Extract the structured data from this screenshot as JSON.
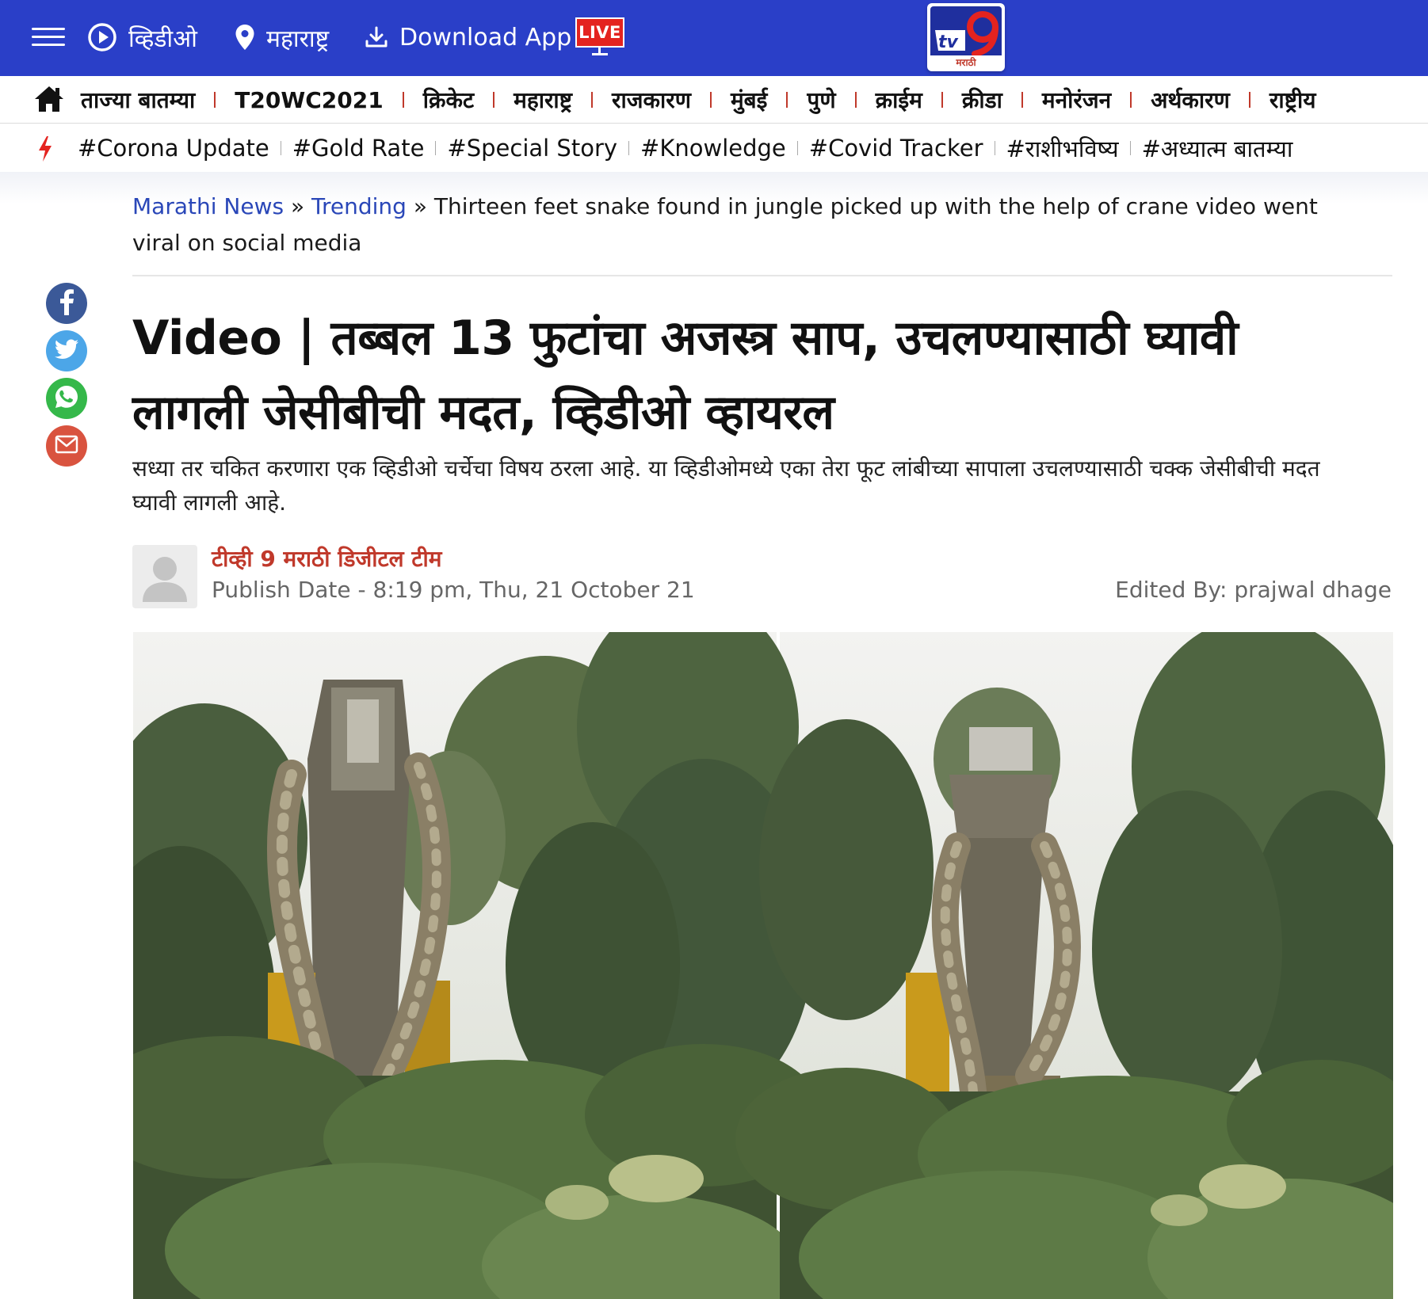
{
  "topbar": {
    "video_label": "व्हिडीओ",
    "location_label": "महाराष्ट्र",
    "download_label": "Download App",
    "live_label": "LIVE",
    "logo_text": "tv9",
    "logo_subtext": "मराठी",
    "bg_color": "#2a3fc8"
  },
  "category_nav": {
    "items": [
      {
        "label": "ताज्या बातम्या"
      },
      {
        "label": "T20WC2021"
      },
      {
        "label": "क्रिकेट"
      },
      {
        "label": "महाराष्ट्र"
      },
      {
        "label": "राजकारण"
      },
      {
        "label": "मुंबई"
      },
      {
        "label": "पुणे"
      },
      {
        "label": "क्राईम"
      },
      {
        "label": "क्रीडा"
      },
      {
        "label": "मनोरंजन"
      },
      {
        "label": "अर्थकारण"
      },
      {
        "label": "राष्ट्रीय"
      }
    ]
  },
  "tag_nav": {
    "items": [
      {
        "label": "#Corona Update"
      },
      {
        "label": "#Gold Rate"
      },
      {
        "label": "#Special Story"
      },
      {
        "label": "#Knowledge"
      },
      {
        "label": "#Covid Tracker"
      },
      {
        "label": "#राशीभविष्य"
      },
      {
        "label": "#अध्यात्म बातम्या"
      }
    ]
  },
  "breadcrumb": {
    "items": [
      {
        "label": "Marathi News"
      },
      {
        "label": "Trending"
      }
    ],
    "separator": "»",
    "current": "Thirteen feet snake found in jungle picked up with the help of crane video went viral on social media"
  },
  "article": {
    "headline": "Video | तब्बल 13 फुटांचा अजस्त्र साप, उचलण्यासाठी घ्यावी लागली जेसीबीची मदत, व्हिडीओ व्हायरल",
    "summary": "सध्या तर चकित करणारा एक व्हिडीओ चर्चेचा विषय ठरला आहे. या व्हिडीओमध्ये एका तेरा फूट लांबीच्या सापाला उचलण्यासाठी चक्क जेसीबीची मदत घ्यावी लागली आहे.",
    "author": "टीव्ही 9 मराठी डिजीटल टीम",
    "publish_date": "Publish Date - 8:19 pm, Thu, 21 October 21",
    "edited_by": "Edited By: prajwal dhage"
  },
  "share": {
    "icons": [
      "facebook-icon",
      "twitter-icon",
      "whatsapp-icon",
      "mail-icon"
    ]
  },
  "colors": {
    "accent_red": "#c0392b",
    "link_blue": "#2a47b8",
    "live_red": "#e4231f"
  }
}
